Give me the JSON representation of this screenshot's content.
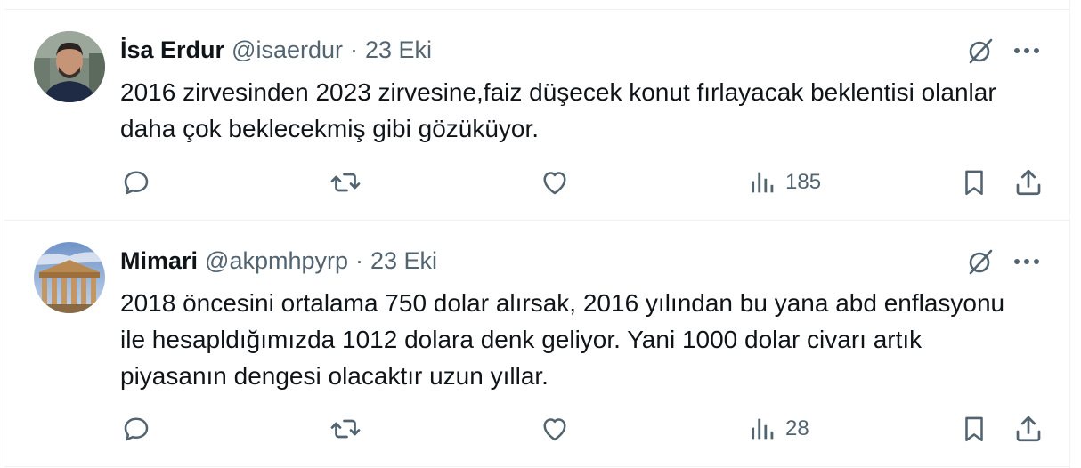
{
  "colors": {
    "text": "#0f1419",
    "secondary": "#536471",
    "border": "#eff3f4"
  },
  "tweets": [
    {
      "name": "İsa Erdur",
      "handle": "@isaerdur",
      "separator": "·",
      "date": "23 Eki",
      "text": "2016 zirvesinden 2023 zirvesine,faiz düşecek konut fırlayacak beklentisi olanlar daha çok beklecekmiş gibi gözüküyor.",
      "views": "185"
    },
    {
      "name": "Mimari",
      "handle": "@akpmhpyrp",
      "separator": "·",
      "date": "23 Eki",
      "text": "2018 öncesini ortalama 750 dolar alırsak, 2016 yılından bu yana abd enflasyonu ile hesapldığımızda 1012 dolara denk geliyor. Yani 1000 dolar civarı artık piyasanın dengesi olacaktır uzun yıllar.",
      "views": "28"
    }
  ]
}
